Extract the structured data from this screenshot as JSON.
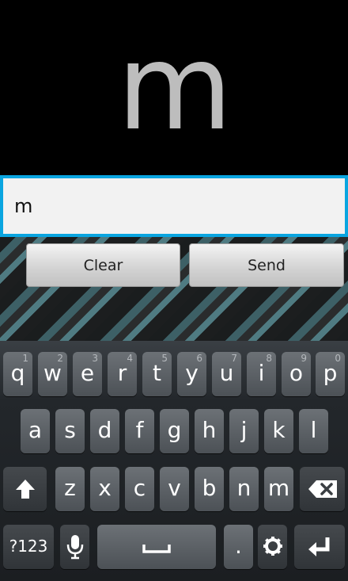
{
  "display": {
    "big_letter": "m"
  },
  "input": {
    "value": "m"
  },
  "buttons": {
    "clear": "Clear",
    "send": "Send"
  },
  "keyboard": {
    "row1": [
      {
        "key": "q",
        "hint": "1"
      },
      {
        "key": "w",
        "hint": "2"
      },
      {
        "key": "e",
        "hint": "3"
      },
      {
        "key": "r",
        "hint": "4"
      },
      {
        "key": "t",
        "hint": "5"
      },
      {
        "key": "y",
        "hint": "6"
      },
      {
        "key": "u",
        "hint": "7"
      },
      {
        "key": "i",
        "hint": "8"
      },
      {
        "key": "o",
        "hint": "9"
      },
      {
        "key": "p",
        "hint": "0"
      }
    ],
    "row2": [
      "a",
      "s",
      "d",
      "f",
      "g",
      "h",
      "j",
      "k",
      "l"
    ],
    "row3": [
      "z",
      "x",
      "c",
      "v",
      "b",
      "n",
      "m"
    ],
    "symbols_label": "?123",
    "period": ".",
    "icons": {
      "shift": "shift-arrow-icon",
      "backspace": "backspace-icon",
      "mic": "microphone-icon",
      "space": "space-bar-icon",
      "settings": "gear-icon",
      "enter": "enter-arrow-icon"
    }
  }
}
